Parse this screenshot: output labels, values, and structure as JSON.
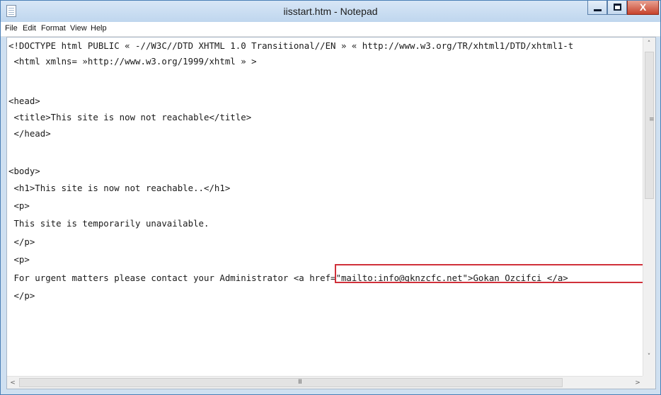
{
  "window": {
    "title": "iisstart.htm - Notepad",
    "icons": {
      "app": "notepad-icon",
      "minimize": "minimize-icon",
      "maximize": "maximize-icon",
      "close": "close-icon"
    },
    "close_glyph": "X"
  },
  "menu": [
    "File",
    "Edit",
    "Format",
    "View",
    "Help"
  ],
  "editor": {
    "lines": [
      "<!DOCTYPE html PUBLIC « -//W3C//DTD XHTML 1.0 Transitional//EN » « http://www.w3.org/TR/xhtml1/DTD/xhtml1-t",
      " <html xmlns= »http://www.w3.org/1999/xhtml » >",
      "",
      "<head>",
      " <title>This site is now not reachable</title>",
      " </head>",
      "",
      "<body>",
      " <h1>This site is now not reachable..</h1>",
      " <p>",
      " This site is temporarily unavailable.",
      " </p>",
      " <p>",
      " For urgent matters please contact your Administrator <a href=\"mailto:info@gknzcfc.net\">Gokan Ozcifci </a>",
      " </p>"
    ],
    "highlight_color": "#d0303a"
  },
  "scrollbars": {
    "up_arrow": "˄",
    "down_arrow": "˅",
    "left_arrow": "<",
    "right_arrow": ">",
    "v_grip": "≡",
    "h_grip": "III"
  }
}
